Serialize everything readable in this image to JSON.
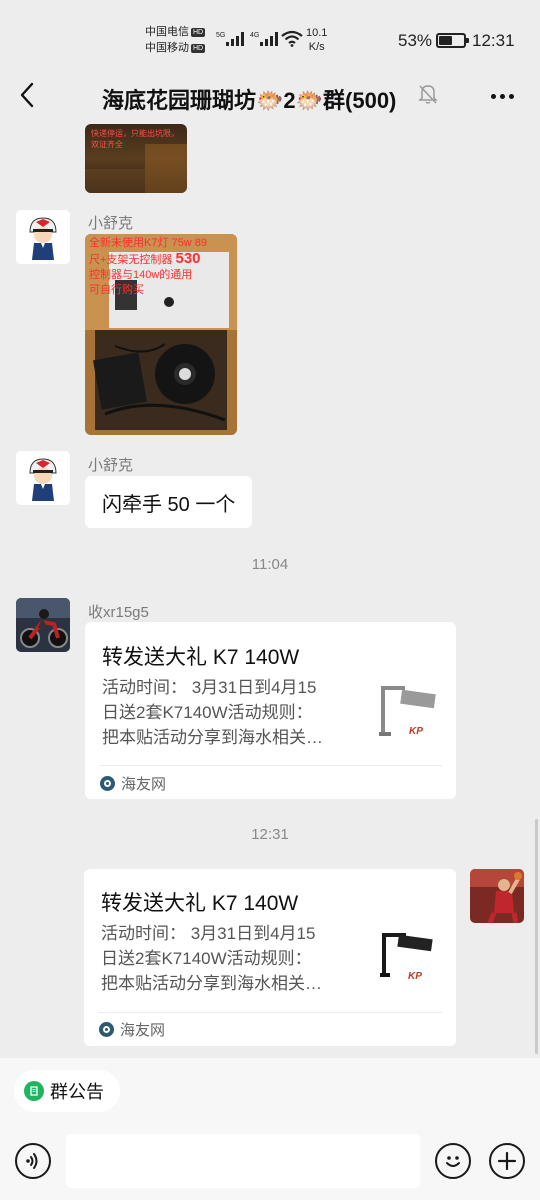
{
  "status_bar": {
    "carrier1": "中国电信",
    "carrier2": "中国移动",
    "hd_badge": "HD",
    "net_5g": "5G",
    "net_4g": "4G",
    "net_speed_value": "10.1",
    "net_speed_unit": "K/s",
    "battery_pct": "53%",
    "battery_level": 0.53,
    "clock": "12:31"
  },
  "title_bar": {
    "title": "海底花园珊瑚坊🐡2🐡群(500)",
    "back_icon": "chevron-left-icon",
    "mute_icon": "bell-off-icon",
    "more_icon": "more-dots-icon"
  },
  "messages": {
    "top_image_caption": [
      "快递停运，只能出坑限，",
      "双证齐全"
    ],
    "m1": {
      "sender": "小舒克",
      "image_caption": [
        "全新未使用K7灯 75w 89",
        "尺+支架无控制器",
        "530",
        "控制器与140w的通用",
        "可自行购买"
      ]
    },
    "m2": {
      "sender": "小舒克",
      "text": "闪牵手 50 一个"
    },
    "time1": "11:04",
    "m3": {
      "sender": "收xr15g5",
      "card_title": "转发送大礼 K7 140W",
      "desc": [
        "活动时间：  3月31日到4月15",
        "日送2套K7140W活动规则：",
        "把本贴活动分享到海水相关…"
      ],
      "source": "海友网"
    },
    "time2": "12:31",
    "m4": {
      "card_title": "转发送大礼 K7 140W",
      "desc": [
        "活动时间：  3月31日到4月15",
        "日送2套K7140W活动规则：",
        "把本贴活动分享到海水相关…"
      ],
      "source": "海友网"
    }
  },
  "bottom": {
    "announcement_label": "群公告",
    "input_value": "",
    "voice_icon": "voice-icon",
    "emoji_icon": "emoji-icon",
    "plus_icon": "plus-icon"
  },
  "colors": {
    "background": "#ededed",
    "bubble": "#ffffff",
    "announce_green": "#1fb55e"
  }
}
